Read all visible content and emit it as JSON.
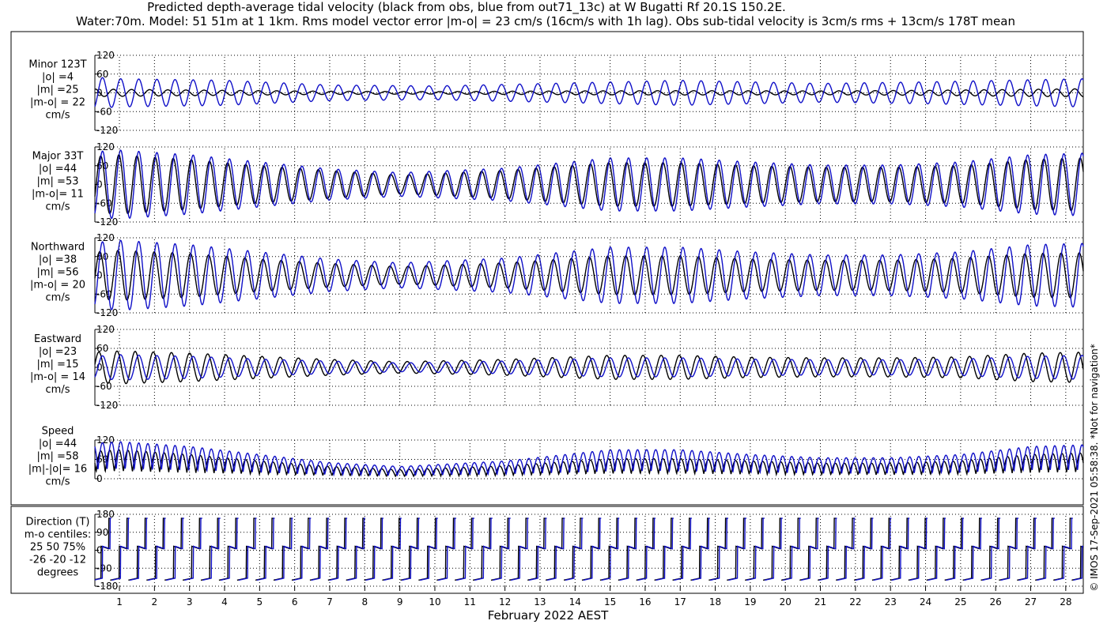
{
  "title_line1": "Predicted depth-average tidal velocity (black from obs, blue from out71_13c) at W Bugatti Rf 20.1S 150.2E.",
  "title_line2": "Water:70m. Model: 51 51m at 1 1km. Rms model vector error |m-o| = 23 cm/s (16cm/s with 1h lag). Obs sub-tidal velocity is 3cm/s rms + 13cm/s 178T mean",
  "xlabel": "February 2022 AEST",
  "side_note": "© IMOS 17-Sep-2021 05:58:38.  *Not for navigation*",
  "colors": {
    "obs": "#000000",
    "model": "#1010c8"
  },
  "chart_data": [
    {
      "type": "line",
      "panel": "minor",
      "label_lines": [
        "Minor 123T",
        "|o| =4",
        "|m| =25",
        "|m-o| = 22",
        "cm/s"
      ],
      "ylim": [
        -120,
        120
      ],
      "yticks": [
        -120,
        -60,
        0,
        60,
        120
      ],
      "yticklabels": [
        "-120",
        "-60",
        "0",
        "60",
        "120"
      ],
      "xlim": [
        0.3,
        28.5
      ],
      "xticks": [
        1,
        2,
        3,
        4,
        5,
        6,
        7,
        8,
        9,
        10,
        11,
        12,
        13,
        14,
        15,
        16,
        17,
        18,
        19,
        20,
        21,
        22,
        23,
        24,
        25,
        26,
        27,
        28
      ],
      "grid": true,
      "series": [
        {
          "role": "obs",
          "kind": "semi",
          "env_days": [
            0.3,
            3,
            7,
            10,
            14,
            17,
            21,
            24,
            28.5
          ],
          "env_amp": [
            12,
            9,
            5,
            4,
            6,
            7,
            6,
            8,
            13
          ],
          "phase": 0.4
        },
        {
          "role": "model",
          "kind": "semi",
          "env_days": [
            0.3,
            1,
            4,
            7,
            10,
            14,
            17,
            21,
            24,
            28.5
          ],
          "env_amp": [
            50,
            45,
            40,
            25,
            22,
            32,
            40,
            30,
            35,
            45
          ],
          "phase": 0.0
        }
      ]
    },
    {
      "type": "line",
      "panel": "major",
      "label_lines": [
        "Major 33T",
        "|o| =44",
        "|m| =53",
        "|m-o|= 11",
        "cm/s"
      ],
      "ylim": [
        -120,
        120
      ],
      "yticks": [
        -120,
        -60,
        0,
        60,
        120
      ],
      "yticklabels": [
        "-120",
        "-60",
        "0",
        "60",
        "120"
      ],
      "xlim": [
        0.3,
        28.5
      ],
      "xticks": [
        1,
        2,
        3,
        4,
        5,
        6,
        7,
        8,
        9,
        10,
        11,
        12,
        13,
        14,
        15,
        16,
        17,
        18,
        19,
        20,
        21,
        22,
        23,
        24,
        25,
        26,
        27,
        28
      ],
      "grid": true,
      "series": [
        {
          "role": "obs",
          "kind": "semi",
          "env_days": [
            0.3,
            1,
            3,
            5,
            7,
            9,
            12,
            15,
            17,
            19,
            21,
            23,
            25,
            27,
            28.5
          ],
          "env_amp": [
            90,
            95,
            80,
            60,
            45,
            30,
            45,
            70,
            70,
            60,
            55,
            55,
            60,
            80,
            85
          ],
          "phase": 0.1
        },
        {
          "role": "model",
          "kind": "semi",
          "env_days": [
            0.3,
            1,
            3,
            5,
            7,
            9,
            12,
            15,
            17,
            19,
            21,
            23,
            25,
            27,
            28.5
          ],
          "env_amp": [
            105,
            110,
            95,
            72,
            50,
            38,
            52,
            85,
            85,
            72,
            62,
            62,
            72,
            95,
            100
          ],
          "phase": 0.0
        }
      ]
    },
    {
      "type": "line",
      "panel": "northward",
      "label_lines": [
        "Northward",
        "|o| =38",
        "|m| =56",
        "|m-o| = 20",
        "cm/s"
      ],
      "ylim": [
        -120,
        120
      ],
      "yticks": [
        -120,
        -60,
        0,
        60,
        120
      ],
      "yticklabels": [
        "-120",
        "-60",
        "0",
        "60",
        "120"
      ],
      "xlim": [
        0.3,
        28.5
      ],
      "xticks": [
        1,
        2,
        3,
        4,
        5,
        6,
        7,
        8,
        9,
        10,
        11,
        12,
        13,
        14,
        15,
        16,
        17,
        18,
        19,
        20,
        21,
        22,
        23,
        24,
        25,
        26,
        27,
        28
      ],
      "grid": true,
      "series": [
        {
          "role": "obs",
          "kind": "semi",
          "env_days": [
            0.3,
            1,
            3,
            5,
            7,
            9,
            12,
            15,
            17,
            19,
            21,
            23,
            25,
            27,
            28.5
          ],
          "env_amp": [
            75,
            80,
            70,
            52,
            38,
            28,
            40,
            62,
            62,
            52,
            48,
            48,
            55,
            70,
            72
          ],
          "phase": 0.15
        },
        {
          "role": "model",
          "kind": "semi",
          "env_days": [
            0.3,
            1,
            3,
            5,
            7,
            9,
            12,
            15,
            17,
            19,
            21,
            23,
            25,
            27,
            28.5
          ],
          "env_amp": [
            105,
            112,
            98,
            75,
            52,
            40,
            55,
            90,
            90,
            75,
            65,
            65,
            75,
            98,
            102
          ],
          "phase": 0.0
        }
      ]
    },
    {
      "type": "line",
      "panel": "eastward",
      "label_lines": [
        "Eastward",
        "|o| =23",
        "|m| =15",
        "|m-o| = 14",
        "cm/s"
      ],
      "ylim": [
        -120,
        120
      ],
      "yticks": [
        -120,
        -60,
        0,
        60,
        120
      ],
      "yticklabels": [
        "-120",
        "-60",
        "0",
        "60",
        "120"
      ],
      "xlim": [
        0.3,
        28.5
      ],
      "xticks": [
        1,
        2,
        3,
        4,
        5,
        6,
        7,
        8,
        9,
        10,
        11,
        12,
        13,
        14,
        15,
        16,
        17,
        18,
        19,
        20,
        21,
        22,
        23,
        24,
        25,
        26,
        27,
        28
      ],
      "grid": true,
      "series": [
        {
          "role": "obs",
          "kind": "semi",
          "env_days": [
            0.3,
            1,
            3,
            5,
            7,
            9,
            12,
            15,
            17,
            19,
            21,
            23,
            25,
            27,
            28.5
          ],
          "env_amp": [
            48,
            52,
            45,
            35,
            25,
            18,
            25,
            38,
            38,
            32,
            30,
            30,
            33,
            45,
            48
          ],
          "phase": 0.2
        },
        {
          "role": "model",
          "kind": "semi",
          "env_days": [
            0.3,
            1,
            3,
            5,
            7,
            9,
            12,
            15,
            17,
            19,
            21,
            23,
            25,
            27,
            28.5
          ],
          "env_amp": [
            35,
            40,
            35,
            26,
            20,
            14,
            20,
            30,
            30,
            26,
            24,
            24,
            26,
            35,
            38
          ],
          "phase": 0.0
        }
      ]
    },
    {
      "type": "line",
      "panel": "speed",
      "label_lines": [
        "Speed",
        "|o| =44",
        "|m| =58",
        "|m|-|o|= 16",
        "cm/s"
      ],
      "ylim": [
        0,
        120
      ],
      "yticks": [
        0,
        60,
        120
      ],
      "yticklabels": [
        "0",
        "60",
        "120"
      ],
      "xlim": [
        0.3,
        28.5
      ],
      "xticks": [
        1,
        2,
        3,
        4,
        5,
        6,
        7,
        8,
        9,
        10,
        11,
        12,
        13,
        14,
        15,
        16,
        17,
        18,
        19,
        20,
        21,
        22,
        23,
        24,
        25,
        26,
        27,
        28
      ],
      "grid": true,
      "series": [
        {
          "role": "obs",
          "kind": "speed",
          "env_days": [
            0.3,
            1,
            3,
            5,
            7,
            9,
            12,
            15,
            17,
            19,
            21,
            23,
            25,
            27,
            28.5
          ],
          "env_amp": [
            85,
            90,
            75,
            55,
            38,
            28,
            40,
            62,
            62,
            55,
            48,
            48,
            55,
            75,
            80
          ],
          "phase": 0.1
        },
        {
          "role": "model",
          "kind": "speed",
          "env_days": [
            0.3,
            1,
            3,
            5,
            7,
            9,
            12,
            15,
            17,
            19,
            21,
            23,
            25,
            27,
            28.5
          ],
          "env_amp": [
            110,
            115,
            100,
            75,
            50,
            38,
            55,
            90,
            90,
            75,
            65,
            65,
            75,
            100,
            105
          ],
          "phase": 0.0
        }
      ]
    },
    {
      "type": "line",
      "panel": "direction",
      "label_lines": [
        "Direction (T)",
        "m-o centiles:",
        "25  50  75%",
        "-26 -20 -12",
        "degrees"
      ],
      "ylim": [
        -180,
        180
      ],
      "yticks": [
        -180,
        -90,
        0,
        90,
        180
      ],
      "yticklabels": [
        "-180",
        "-90",
        "0",
        "90",
        "180"
      ],
      "xlim": [
        0.3,
        28.5
      ],
      "xticks": [
        1,
        2,
        3,
        4,
        5,
        6,
        7,
        8,
        9,
        10,
        11,
        12,
        13,
        14,
        15,
        16,
        17,
        18,
        19,
        20,
        21,
        22,
        23,
        24,
        25,
        26,
        27,
        28
      ],
      "grid": true,
      "series": [
        {
          "role": "obs",
          "kind": "direction",
          "phase": 0.08
        },
        {
          "role": "model",
          "kind": "direction",
          "phase": 0.0
        }
      ]
    }
  ]
}
